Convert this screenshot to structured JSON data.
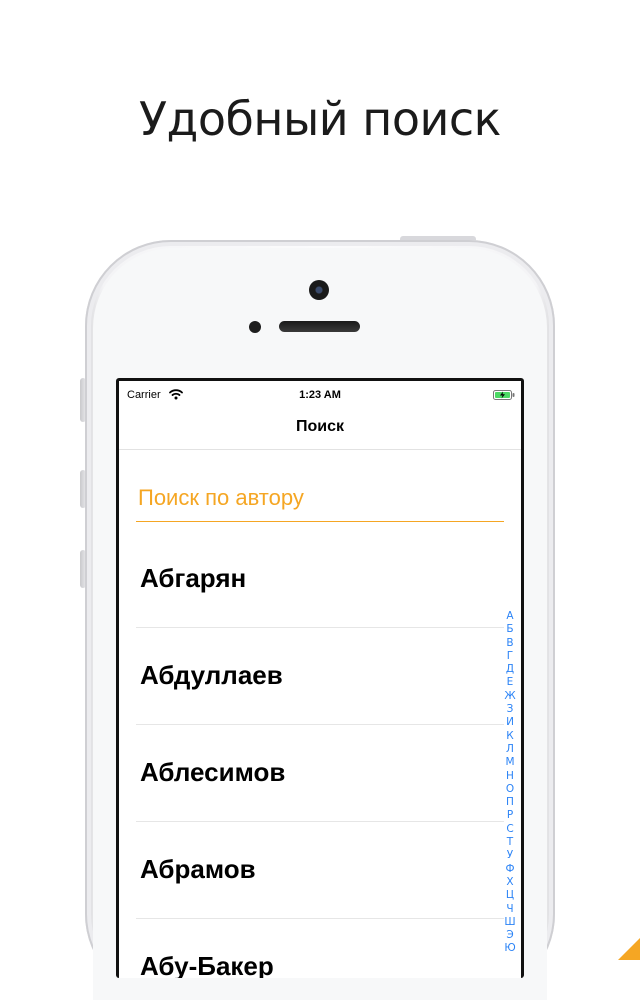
{
  "promo": {
    "headline": "Удобный поиск"
  },
  "statusbar": {
    "carrier": "Carrier",
    "time": "1:23 AM"
  },
  "navbar": {
    "title": "Поиск"
  },
  "search": {
    "label": "Поиск по автору"
  },
  "authors": [
    "Абгарян",
    "Абдуллаев",
    "Аблесимов",
    "Абрамов",
    "Абу-Бакер"
  ],
  "index": [
    "А",
    "Б",
    "В",
    "Г",
    "Д",
    "Е",
    "Ж",
    "З",
    "И",
    "К",
    "Л",
    "М",
    "Н",
    "О",
    "П",
    "Р",
    "С",
    "Т",
    "У",
    "Ф",
    "Х",
    "Ц",
    "Ч",
    "Ш",
    "Э",
    "Ю"
  ],
  "colors": {
    "accent": "#f5a623",
    "index": "#2b83f6"
  }
}
